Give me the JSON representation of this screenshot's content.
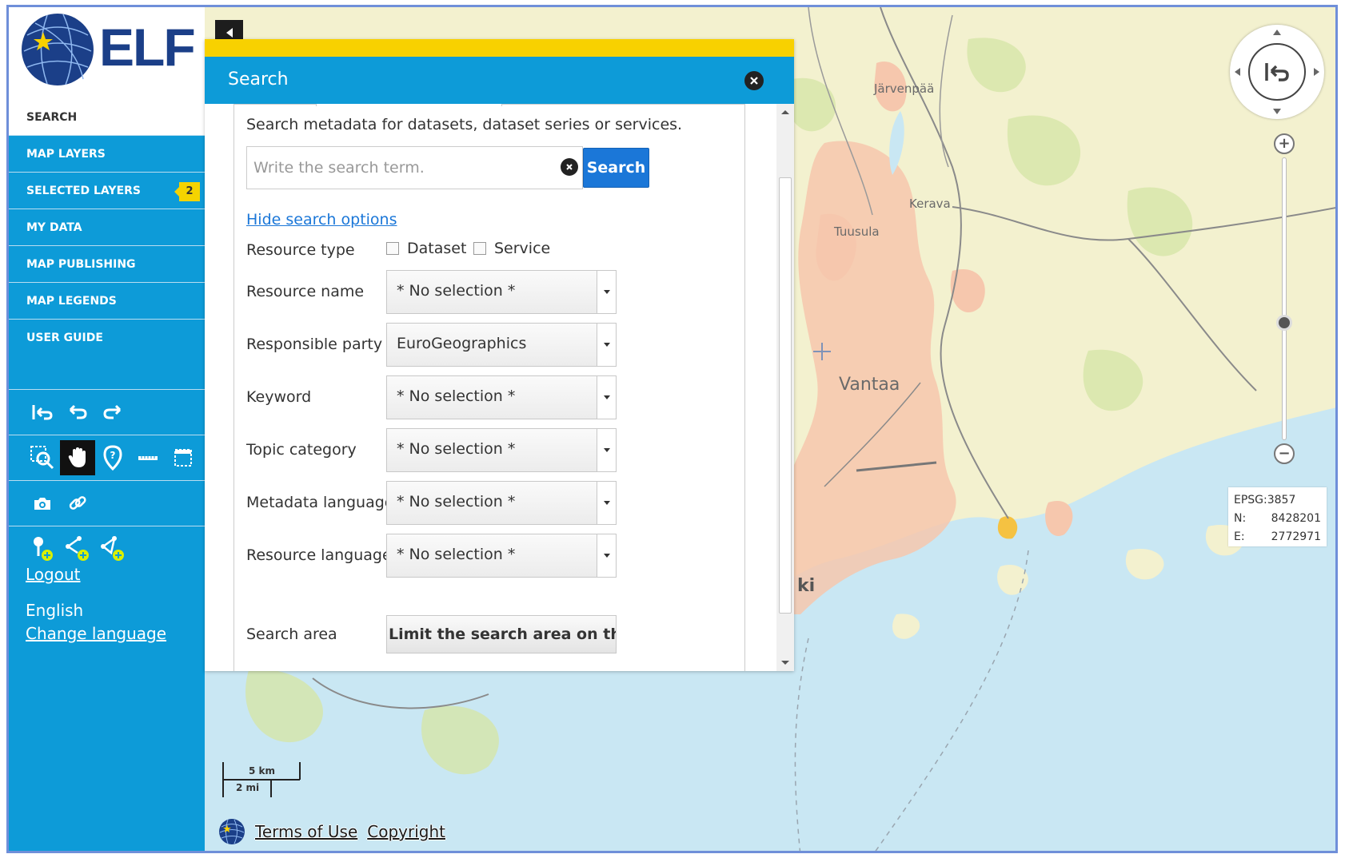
{
  "brand": {
    "name": "ELF"
  },
  "nav": {
    "items": [
      {
        "label": "SEARCH",
        "active": true
      },
      {
        "label": "MAP LAYERS"
      },
      {
        "label": "SELECTED LAYERS",
        "badge": "2"
      },
      {
        "label": "MY DATA"
      },
      {
        "label": "MAP PUBLISHING"
      },
      {
        "label": "MAP LEGENDS"
      },
      {
        "label": "USER GUIDE"
      }
    ]
  },
  "tools": {
    "history": [
      "reset-view-icon",
      "undo-icon",
      "redo-icon"
    ],
    "navigation": [
      "zoom-box-icon",
      "pan-hand-icon",
      "get-info-icon",
      "measure-line-icon",
      "measure-area-icon"
    ],
    "misc": [
      "camera-icon",
      "link-icon"
    ],
    "draw": [
      "add-point-icon",
      "add-line-icon",
      "add-area-icon"
    ]
  },
  "account": {
    "logout": "Logout",
    "language": "English",
    "change_language": "Change language"
  },
  "search_panel": {
    "title": "Search",
    "description": "Search metadata for datasets, dataset series or services.",
    "input_placeholder": "Write the search term.",
    "input_value": "",
    "search_button": "Search",
    "toggle_options": "Hide search options",
    "resource_type": {
      "label": "Resource type",
      "options": [
        "Dataset",
        "Service"
      ]
    },
    "fields": [
      {
        "label": "Resource name",
        "value": "* No selection *"
      },
      {
        "label": "Responsible party",
        "value": "EuroGeographics"
      },
      {
        "label": "Keyword",
        "value": "* No selection *"
      },
      {
        "label": "Topic category",
        "value": "* No selection *"
      },
      {
        "label": "Metadata language",
        "value": "* No selection *"
      },
      {
        "label": "Resource language",
        "value": "* No selection *"
      }
    ],
    "search_area": {
      "label": "Search area",
      "button": "Limit the search area on the map"
    }
  },
  "map": {
    "places": [
      "Järvenpää",
      "Kerava",
      "Tuusula",
      "Vantaa",
      "ki"
    ],
    "coordinates": {
      "crs": "EPSG:3857",
      "n_label": "N:",
      "n": "8428201",
      "e_label": "E:",
      "e": "2772971"
    },
    "scale": {
      "metric": "5 km",
      "imperial": "2 mi"
    }
  },
  "footer": {
    "terms": "Terms of Use",
    "copyright": "Copyright"
  },
  "colors": {
    "brand_blue": "#0d9bd8",
    "accent_yellow": "#f8d100",
    "button_blue": "#1b77d8",
    "logo_navy": "#1b3f88"
  }
}
